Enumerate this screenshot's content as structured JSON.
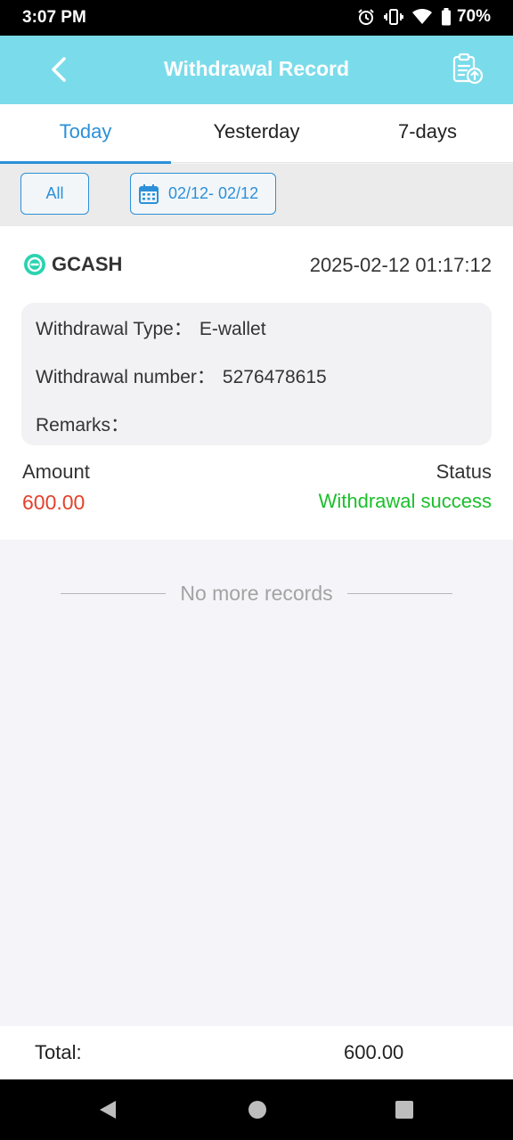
{
  "status_bar": {
    "time": "3:07 PM",
    "battery": "70%",
    "icons": [
      "alarm-icon",
      "vibrate-icon",
      "wifi-icon",
      "battery-icon"
    ]
  },
  "header": {
    "title": "Withdrawal Record",
    "back_icon": "chevron-left-icon",
    "action_icon": "clipboard-upload-icon"
  },
  "tabs": [
    {
      "label": "Today",
      "active": true
    },
    {
      "label": "Yesterday",
      "active": false
    },
    {
      "label": "7-days",
      "active": false
    }
  ],
  "filter": {
    "all_label": "All",
    "date_range": "02/12- 02/12",
    "calendar_icon": "calendar-icon"
  },
  "record": {
    "method": "GCASH",
    "datetime": "2025-02-12 01:17:12",
    "type_label": "Withdrawal Type：",
    "type_value": "E-wallet",
    "number_label": "Withdrawal number：",
    "number_value": "5276478615",
    "remarks_label": "Remarks：",
    "remarks_value": "",
    "amount_label": "Amount",
    "amount_value": "600.00",
    "status_label": "Status",
    "status_value": "Withdrawal success"
  },
  "list_end": "No more records",
  "total": {
    "label": "Total:",
    "value": "600.00"
  },
  "colors": {
    "header": "#7adcea",
    "accent": "#2b90d8",
    "amount": "#e4412b",
    "success": "#1bbf2b",
    "gcash": "#2ad3b0"
  }
}
